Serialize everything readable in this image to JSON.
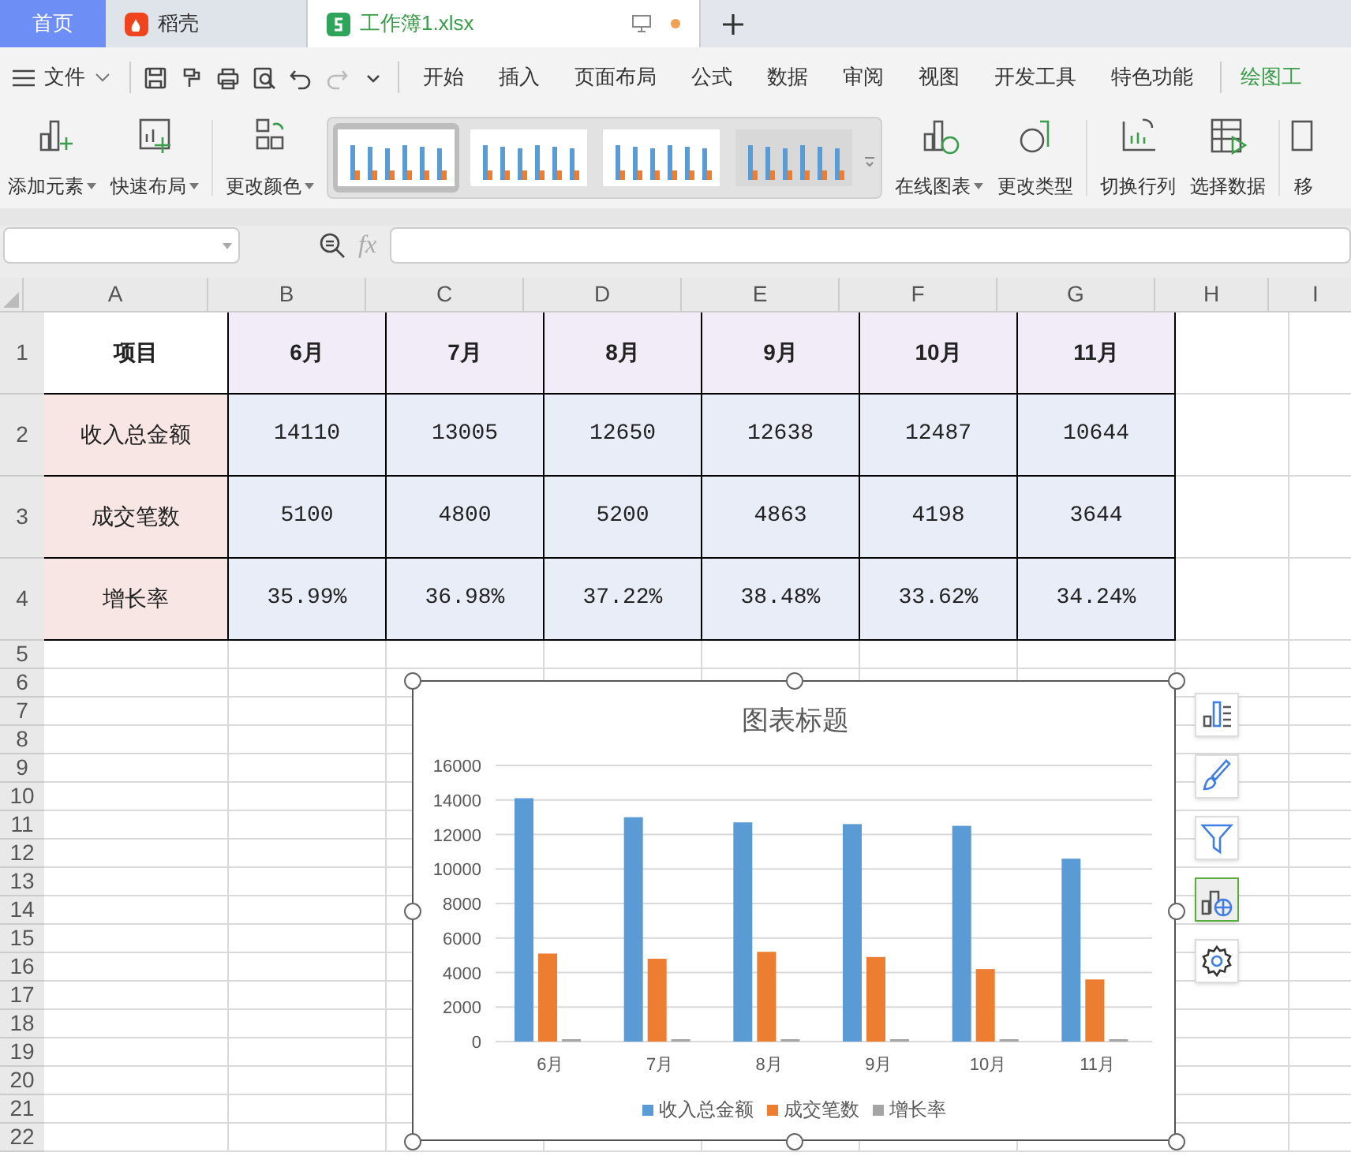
{
  "tabs": [
    {
      "label": "首页",
      "kind": "home",
      "selected": false
    },
    {
      "label": "稻壳",
      "kind": "app",
      "selected": false
    },
    {
      "label": "工作簿1.xlsx",
      "kind": "doc",
      "selected": true,
      "unsaved": true
    }
  ],
  "menu": {
    "file": "文件",
    "tabs": [
      {
        "label": "开始",
        "selected": false
      },
      {
        "label": "插入",
        "selected": false
      },
      {
        "label": "页面布局",
        "selected": false
      },
      {
        "label": "公式",
        "selected": false
      },
      {
        "label": "数据",
        "selected": false
      },
      {
        "label": "审阅",
        "selected": false
      },
      {
        "label": "视图",
        "selected": false
      },
      {
        "label": "开发工具",
        "selected": false
      },
      {
        "label": "特色功能",
        "selected": false
      },
      {
        "label": "绘图工",
        "selected": true
      }
    ]
  },
  "ribbon": {
    "left": [
      {
        "label": "添加元素",
        "kind": "add",
        "dropdown": true
      },
      {
        "label": "快速布局",
        "kind": "layout",
        "dropdown": true
      },
      {
        "label": "更改颜色",
        "kind": "color",
        "dropdown": true
      }
    ],
    "styles": [
      {
        "selected": true
      },
      {
        "selected": false
      },
      {
        "selected": false
      },
      {
        "selected": false
      }
    ],
    "right": [
      {
        "label": "在线图表",
        "kind": "online",
        "dropdown": true
      },
      {
        "label": "更改类型",
        "kind": "type",
        "dropdown": false
      },
      {
        "label": "切换行列",
        "kind": "switch",
        "dropdown": false
      },
      {
        "label": "选择数据",
        "kind": "select",
        "dropdown": false
      },
      {
        "label": "移",
        "kind": "move",
        "dropdown": false
      }
    ]
  },
  "formula_bar": {
    "fx": "fx"
  },
  "columns": [
    "A",
    "B",
    "C",
    "D",
    "E",
    "F",
    "G",
    "H",
    "I"
  ],
  "rows": [
    "1",
    "2",
    "3",
    "4",
    "5",
    "6",
    "7",
    "8",
    "9",
    "10",
    "11",
    "12",
    "13",
    "14",
    "15",
    "16",
    "17",
    "18",
    "19",
    "20",
    "21",
    "22"
  ],
  "table": {
    "header": [
      "项目",
      "6月",
      "7月",
      "8月",
      "9月",
      "10月",
      "11月"
    ],
    "rows": [
      [
        "收入总金额",
        "14110",
        "13005",
        "12650",
        "12638",
        "12487",
        "10644"
      ],
      [
        "成交笔数",
        "5100",
        "4800",
        "5200",
        "4863",
        "4198",
        "3644"
      ],
      [
        "增长率",
        "35.99%",
        "36.98%",
        "37.22%",
        "38.48%",
        "33.62%",
        "34.24%"
      ]
    ]
  },
  "chart": {
    "chart_data": {
      "type": "bar",
      "title": "图表标题",
      "categories": [
        "6月",
        "7月",
        "8月",
        "9月",
        "10月",
        "11月"
      ],
      "series": [
        {
          "name": "收入总金额",
          "color": "#5b9bd5",
          "values": [
            14100,
            13000,
            12700,
            12600,
            12500,
            10600
          ]
        },
        {
          "name": "成交笔数",
          "color": "#ed7d31",
          "values": [
            5100,
            4800,
            5200,
            4900,
            4200,
            3600
          ]
        },
        {
          "name": "增长率",
          "color": "#a5a5a5",
          "values": [
            0,
            0,
            0,
            0,
            0,
            0
          ]
        }
      ],
      "ylim": [
        0,
        16000
      ],
      "yticks": [
        0,
        2000,
        4000,
        6000,
        8000,
        10000,
        12000,
        14000,
        16000
      ],
      "grid": true,
      "legend": "bottom"
    }
  },
  "side_tools": [
    {
      "kind": "elements",
      "selected": false
    },
    {
      "kind": "brush",
      "selected": false
    },
    {
      "kind": "filter",
      "selected": false
    },
    {
      "kind": "online",
      "selected": true
    },
    {
      "kind": "settings",
      "selected": false
    }
  ]
}
